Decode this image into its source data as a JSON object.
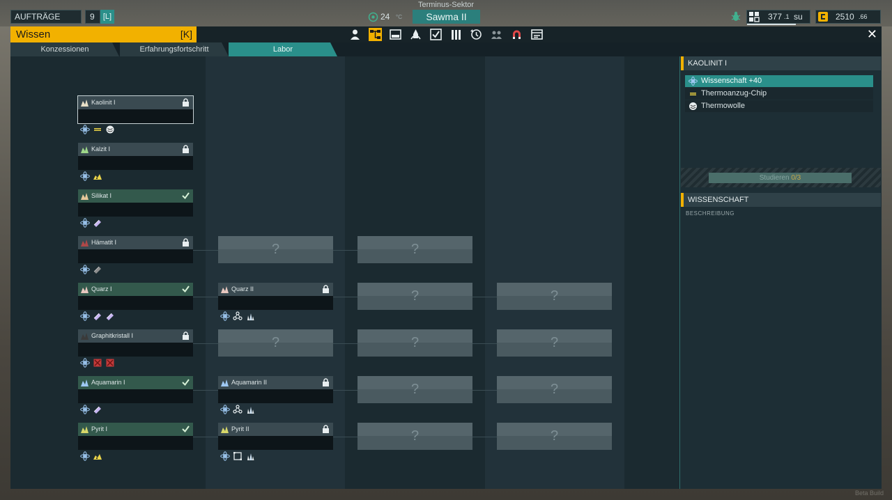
{
  "hud": {
    "orders_label": "AUFTRÄGE",
    "orders_count": "9",
    "orders_key": "[L]",
    "sector": "Terminus-Sektor",
    "temperature": "24",
    "temperature_unit": "°C",
    "planet": "Sawma II",
    "storage_value": "377",
    "storage_fraction": ".1",
    "storage_unit": "su",
    "credits_value": "2510",
    "credits_fraction": ".66"
  },
  "window": {
    "title": "Wissen",
    "title_key": "[K]",
    "close": "✕",
    "top_icons": [
      {
        "name": "personnel-icon",
        "active": false
      },
      {
        "name": "knowledge-tree-icon",
        "active": true
      },
      {
        "name": "terminal-icon",
        "active": false
      },
      {
        "name": "rocket-icon",
        "active": false
      },
      {
        "name": "checklist-icon",
        "active": false
      },
      {
        "name": "encyclopedia-icon",
        "active": false
      },
      {
        "name": "history-icon",
        "active": false
      },
      {
        "name": "colonists-icon",
        "active": false
      },
      {
        "name": "magnet-icon",
        "active": false
      },
      {
        "name": "log-icon",
        "active": false
      }
    ],
    "tabs": [
      {
        "label": "Konzessionen",
        "active": false
      },
      {
        "label": "Erfahrungsfortschritt",
        "active": false
      },
      {
        "label": "Labor",
        "active": true
      }
    ]
  },
  "tree": {
    "unknown_label": "?",
    "rows": [
      {
        "tier1": {
          "name": "Kaolinit I",
          "state": "locked",
          "selected": true,
          "rewards": [
            "science",
            "chip",
            "wool"
          ]
        }
      },
      {
        "tier1": {
          "name": "Kalzit I",
          "state": "locked",
          "rewards": [
            "science",
            "ore"
          ]
        }
      },
      {
        "tier1": {
          "name": "Silikat I",
          "state": "done",
          "rewards": [
            "science",
            "crystal-bar"
          ]
        }
      },
      {
        "tier1": {
          "name": "Hämatit I",
          "state": "locked",
          "rewards": [
            "science",
            "metal-bar"
          ]
        }
      },
      {
        "tier1": {
          "name": "Quarz I",
          "state": "done",
          "rewards": [
            "science",
            "crystal-bar",
            "crystal-bar"
          ]
        },
        "tier2": {
          "name": "Quarz II",
          "state": "locked",
          "rewards": [
            "science",
            "molecule",
            "crystal-cluster"
          ]
        }
      },
      {
        "tier1": {
          "name": "Graphitkristall I",
          "state": "locked",
          "rewards": [
            "science",
            "red-crate",
            "red-crate"
          ]
        }
      },
      {
        "tier1": {
          "name": "Aquamarin I",
          "state": "done",
          "rewards": [
            "science",
            "crystal-bar"
          ]
        },
        "tier2": {
          "name": "Aquamarin II",
          "state": "locked",
          "rewards": [
            "science",
            "molecule",
            "crystal-cluster"
          ]
        }
      },
      {
        "tier1": {
          "name": "Pyrit I",
          "state": "done",
          "rewards": [
            "science",
            "ore"
          ]
        },
        "tier2": {
          "name": "Pyrit II",
          "state": "locked",
          "rewards": [
            "science",
            "frame",
            "crystal-cluster"
          ]
        }
      }
    ]
  },
  "panel": {
    "heading": "KAOLINIT I",
    "rewards": [
      {
        "label": "Wissenschaft +40",
        "icon": "science-icon",
        "active": true
      },
      {
        "label": "Thermoanzug-Chip",
        "icon": "chip-icon",
        "active": false
      },
      {
        "label": "Thermowolle",
        "icon": "wool-icon",
        "active": false
      }
    ],
    "study_label": "Studieren",
    "study_progress": "0/3",
    "section_heading": "WISSENSCHAFT",
    "section_subheading": "BESCHREIBUNG"
  },
  "footer": {
    "build": "Beta Build"
  },
  "colors": {
    "accent_yellow": "#f2b100",
    "accent_teal": "#2a8f8a",
    "done_green": "#33594c",
    "panel_bg": "#1d2e35"
  }
}
